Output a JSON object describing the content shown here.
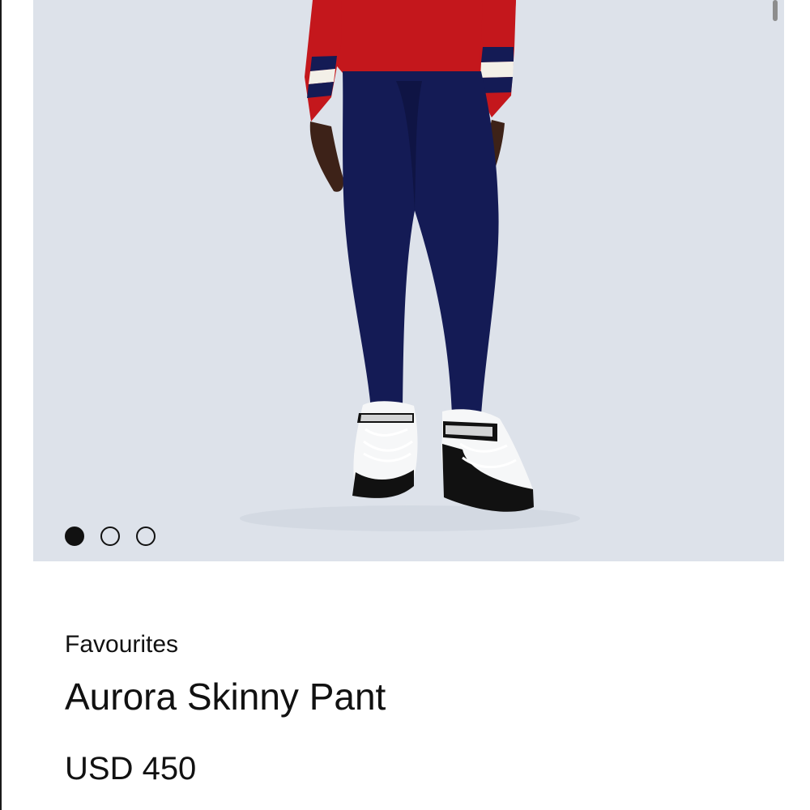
{
  "product": {
    "category": "Favourites",
    "name": "Aurora Skinny Pant",
    "price": "USD 450"
  },
  "gallery": {
    "image_count": 3,
    "active_index": 0,
    "image_description_icon": "product-photo-model-icon"
  },
  "colors": {
    "hero_background": "#dde2ea",
    "sweater": "#c4171c",
    "pants": "#141b55",
    "stripe_navy": "#141b55",
    "stripe_white": "#f3f0e8",
    "boot_black": "#111111",
    "boot_white": "#f6f7f8"
  }
}
